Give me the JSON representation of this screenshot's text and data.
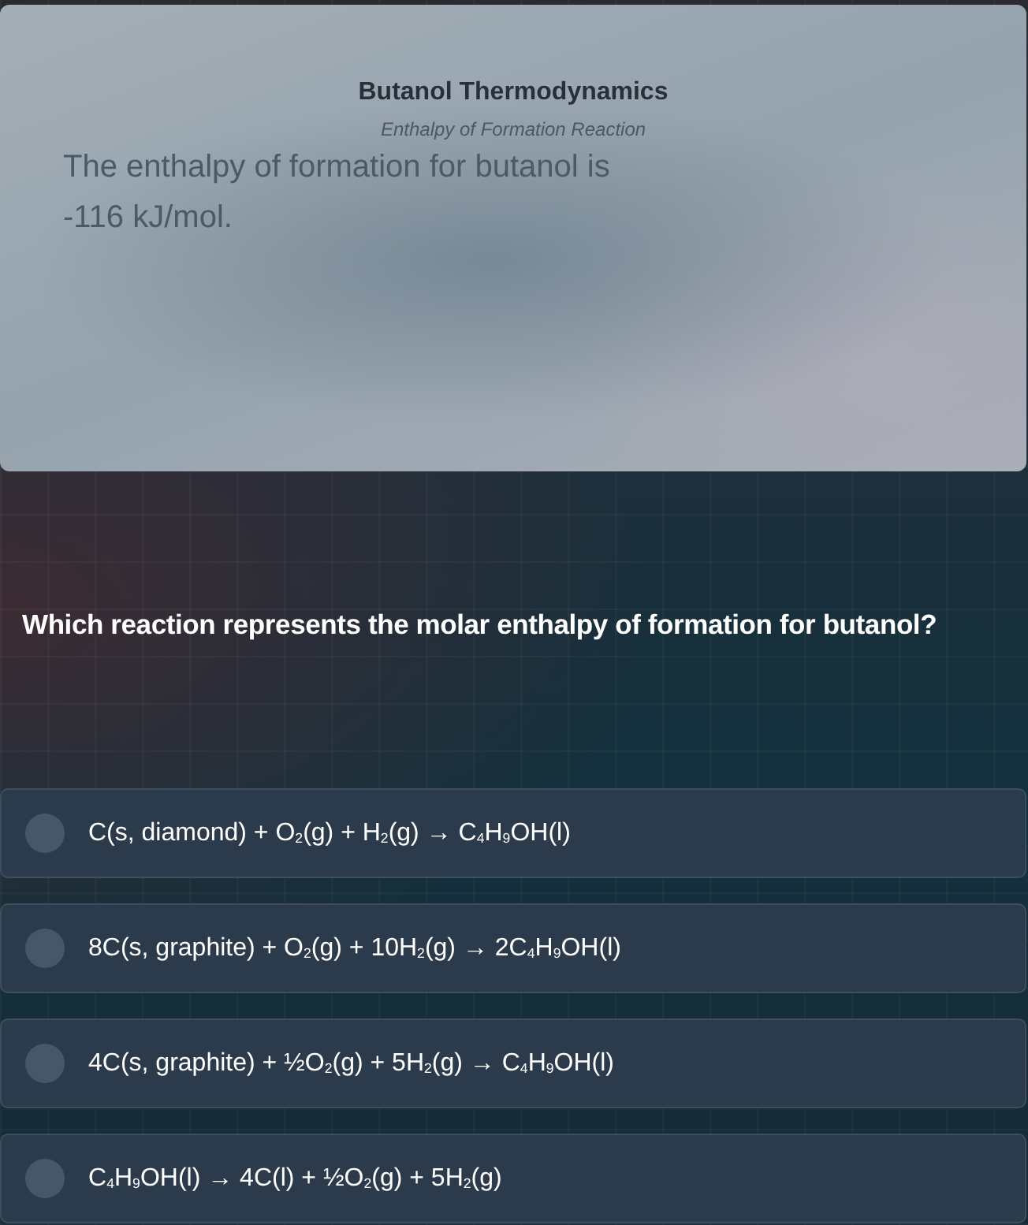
{
  "info_card": {
    "title": "Butanol Thermodynamics",
    "subtitle": "Enthalpy of Formation Reaction",
    "body": "The enthalpy of formation for butanol is -116 kJ/mol."
  },
  "question": "Which reaction represents the molar enthalpy of formation for butanol?",
  "options": [
    {
      "text": "C(s, diamond) + O$_{2}$(g) + H$_{2}$(g) → C$_{4}$H$_{9}$OH(l)",
      "selected": false
    },
    {
      "text": "8C(s, graphite) + O$_{2}$(g) + 10H$_{2}$(g) → 2C$_{4}$H$_{9}$OH(l)",
      "selected": false
    },
    {
      "text": "4C(s, graphite) + ½O$_{2}$(g) + 5H$_{2}$(g) → C$_{4}$H$_{9}$OH(l)",
      "selected": false
    },
    {
      "text": "C$_{4}$H$_{9}$OH(l) → 4C(l) + ½O$_{2}$(g) + 5H$_{2}$(g)",
      "selected": false
    }
  ]
}
